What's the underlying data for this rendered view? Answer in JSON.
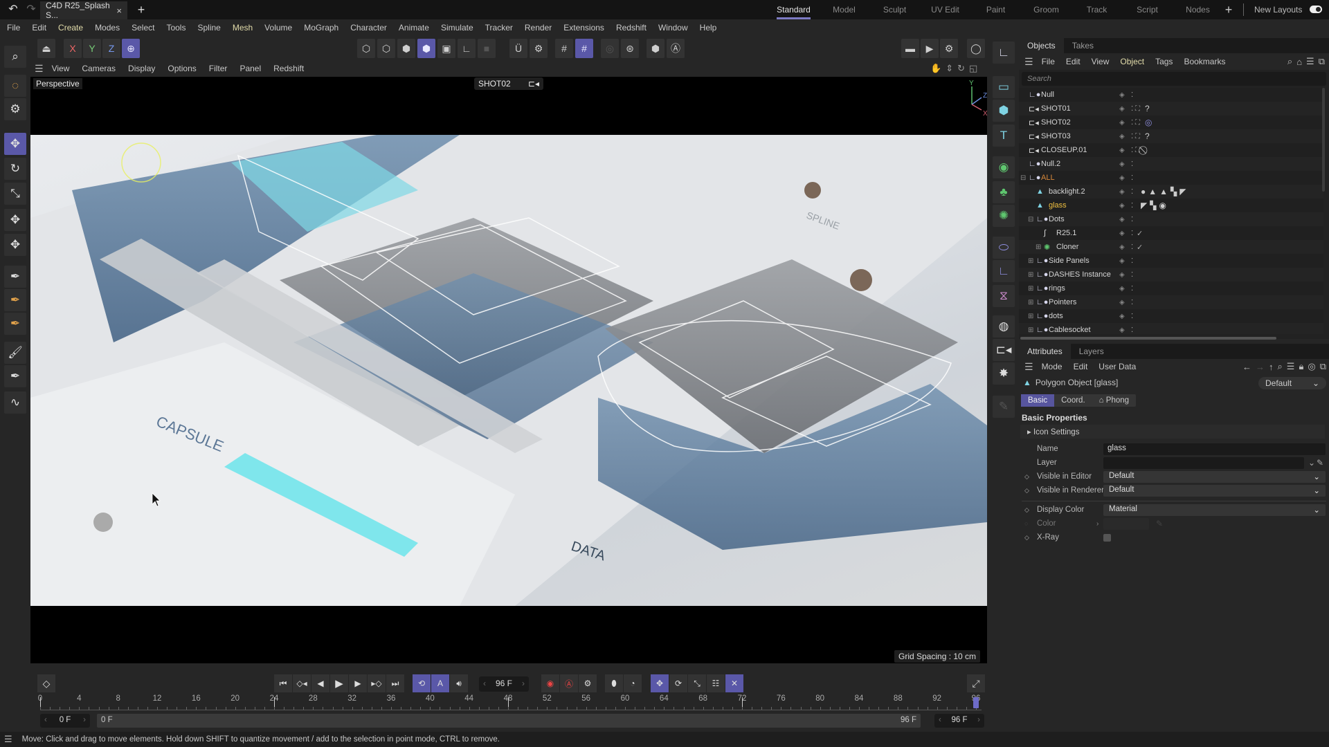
{
  "titlebar": {
    "undo_icon": "undo-icon",
    "redo_icon": "redo-icon",
    "document_tab": "C4D R25_Splash S...",
    "close_tab": "×",
    "new_tab": "+",
    "layouts": [
      "Standard",
      "Model",
      "Sculpt",
      "UV Edit",
      "Paint",
      "Groom",
      "Track",
      "Script",
      "Nodes"
    ],
    "active_layout": "Standard",
    "add_layout": "+",
    "new_layouts_label": "New Layouts",
    "new_layouts_toggle": true
  },
  "menubar": [
    "File",
    "Edit",
    "Create",
    "Modes",
    "Select",
    "Tools",
    "Spline",
    "Mesh",
    "Volume",
    "MoGraph",
    "Character",
    "Animate",
    "Simulate",
    "Tracker",
    "Render",
    "Extensions",
    "Redshift",
    "Window",
    "Help"
  ],
  "toolbar": {
    "axis_x": "X",
    "axis_y": "Y",
    "axis_z": "Z"
  },
  "viewport": {
    "menu": [
      "View",
      "Cameras",
      "Display",
      "Options",
      "Filter",
      "Panel",
      "Redshift"
    ],
    "view_name": "Perspective",
    "camera": "SHOT02",
    "grid_spacing": "Grid Spacing : 10 cm",
    "axis": {
      "x": "X",
      "y": "Y",
      "z": "Z"
    },
    "scene_labels": [
      "CAPSULE",
      "DATA",
      "SPLINE"
    ]
  },
  "object_manager": {
    "tabs": [
      "Objects",
      "Takes"
    ],
    "active_tab": "Objects",
    "menu": [
      "File",
      "Edit",
      "View",
      "Object",
      "Tags",
      "Bookmarks"
    ],
    "search_placeholder": "Search",
    "objects": [
      {
        "name": "Null",
        "type": "null",
        "depth": 0,
        "tags": []
      },
      {
        "name": "SHOT01",
        "type": "camera",
        "depth": 0,
        "tags": [
          "?"
        ]
      },
      {
        "name": "SHOT02",
        "type": "camera",
        "depth": 0,
        "tags": [
          "◎"
        ],
        "active_camera": true
      },
      {
        "name": "SHOT03",
        "type": "camera",
        "depth": 0,
        "tags": [
          "?"
        ]
      },
      {
        "name": "CLOSEUP.01",
        "type": "camera",
        "depth": 0,
        "tags": [
          "⃠"
        ]
      },
      {
        "name": "Null.2",
        "type": "null",
        "depth": 0,
        "tags": []
      },
      {
        "name": "ALL",
        "type": "null",
        "depth": 0,
        "tags": [],
        "expanded": true,
        "color": "#d7883a"
      },
      {
        "name": "backlight.2",
        "type": "polygon",
        "depth": 1,
        "tags": [
          "●",
          "▲",
          "▲",
          "▚",
          "◤"
        ]
      },
      {
        "name": "glass",
        "type": "polygon",
        "depth": 1,
        "tags": [
          "◤",
          "▚",
          "◉"
        ],
        "selected": true,
        "color": "#f0c040"
      },
      {
        "name": "Dots",
        "type": "null",
        "depth": 1,
        "tags": [],
        "expanded": true
      },
      {
        "name": "R25.1",
        "type": "spline",
        "depth": 2,
        "tags": [],
        "check": true
      },
      {
        "name": "Cloner",
        "type": "cloner",
        "depth": 2,
        "tags": [],
        "check": true,
        "collapsed": true
      },
      {
        "name": "Side Panels",
        "type": "null",
        "depth": 1,
        "tags": [],
        "collapsed": true
      },
      {
        "name": "DASHES Instance",
        "type": "null",
        "depth": 1,
        "tags": [],
        "collapsed": true
      },
      {
        "name": "rings",
        "type": "null",
        "depth": 1,
        "tags": [],
        "collapsed": true
      },
      {
        "name": "Pointers",
        "type": "null",
        "depth": 1,
        "tags": [],
        "collapsed": true
      },
      {
        "name": "dots",
        "type": "null",
        "depth": 1,
        "tags": [],
        "collapsed": true
      },
      {
        "name": "Cablesocket",
        "type": "null",
        "depth": 1,
        "tags": [],
        "collapsed": true
      }
    ]
  },
  "attributes": {
    "tabs": [
      "Attributes",
      "Layers"
    ],
    "active_tab": "Attributes",
    "menu": [
      "Mode",
      "Edit",
      "User Data"
    ],
    "object_title": "Polygon Object [glass]",
    "mode_select": "Default",
    "subtabs": [
      "Basic",
      "Coord.",
      "⌂ Phong"
    ],
    "active_subtab": "Basic",
    "section": "Basic Properties",
    "group": "Icon Settings",
    "properties": [
      {
        "label": "Name",
        "value": "glass",
        "kind": "text",
        "keyframe": false
      },
      {
        "label": "Layer",
        "value": "",
        "kind": "link",
        "keyframe": false
      },
      {
        "label": "Visible in Editor",
        "value": "Default",
        "kind": "select",
        "keyframe": true
      },
      {
        "label": "Visible in Renderer",
        "value": "Default",
        "kind": "select",
        "keyframe": true
      },
      {
        "label": "Display Color",
        "value": "Material",
        "kind": "select",
        "keyframe": true
      },
      {
        "label": "Color",
        "value": "",
        "kind": "color",
        "keyframe": false
      },
      {
        "label": "X-Ray",
        "value": false,
        "kind": "checkbox",
        "keyframe": true
      }
    ]
  },
  "timeline": {
    "current_frame": "96 F",
    "ticks": [
      "0",
      "4",
      "8",
      "12",
      "16",
      "20",
      "24",
      "28",
      "32",
      "36",
      "40",
      "44",
      "48",
      "52",
      "56",
      "60",
      "64",
      "68",
      "72",
      "76",
      "80",
      "84",
      "88",
      "92",
      "96"
    ],
    "start_frame": "0 F",
    "range_start": "0 F",
    "range_end": "96 F",
    "end_frame": "96 F",
    "playhead_frame": 96,
    "max_frame": 96
  },
  "statusbar": {
    "message": "Move: Click and drag to move elements. Hold down SHIFT to quantize movement / add to the selection in point mode, CTRL to remove."
  },
  "colors": {
    "accent": "#5a58a8",
    "selected_object": "#f0c040",
    "group_object": "#d7883a",
    "record": "#e04444"
  }
}
